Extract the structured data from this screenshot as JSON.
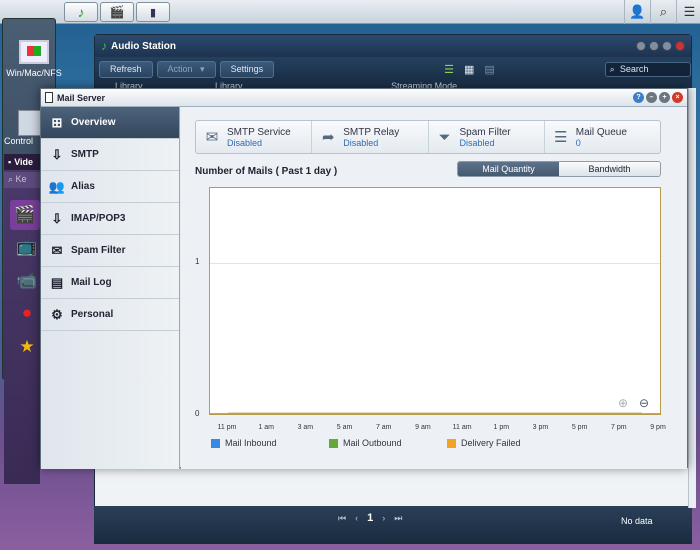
{
  "desktop": {
    "icons": [
      {
        "label": "Win/Mac/NFS"
      },
      {
        "label": "Control"
      }
    ],
    "nodata": "No data"
  },
  "audio_station": {
    "title": "Audio Station",
    "toolbar": {
      "refresh": "Refresh",
      "action": "Action",
      "settings": "Settings",
      "search_placeholder": "Search"
    },
    "subheader": {
      "left": "Library",
      "mid": "Library",
      "right": "Streaming Mode"
    }
  },
  "video_station": {
    "title": "Vide",
    "search": "Ke"
  },
  "mail_server": {
    "title": "Mail Server",
    "nav": [
      {
        "label": "Overview",
        "icon": "overview-icon"
      },
      {
        "label": "SMTP",
        "icon": "smtp-icon"
      },
      {
        "label": "Alias",
        "icon": "alias-icon"
      },
      {
        "label": "IMAP/POP3",
        "icon": "imap-icon"
      },
      {
        "label": "Spam Filter",
        "icon": "spam-filter-icon"
      },
      {
        "label": "Mail Log",
        "icon": "mail-log-icon"
      },
      {
        "label": "Personal",
        "icon": "gear-icon"
      }
    ],
    "status": [
      {
        "name": "SMTP Service",
        "value": "Disabled"
      },
      {
        "name": "SMTP Relay",
        "value": "Disabled"
      },
      {
        "name": "Spam Filter",
        "value": "Disabled"
      },
      {
        "name": "Mail Queue",
        "value": "0"
      }
    ],
    "chart_toggle": {
      "quantity": "Mail Quantity",
      "bandwidth": "Bandwidth",
      "selected": "Mail Quantity"
    }
  },
  "pager": {
    "page": "1"
  },
  "chart_data": {
    "type": "line",
    "title": "Number of Mails ( Past 1 day )",
    "categories": [
      "11 pm",
      "1 am",
      "3 am",
      "5 am",
      "7 am",
      "9 am",
      "11 am",
      "1 pm",
      "3 pm",
      "5 pm",
      "7 pm",
      "9 pm"
    ],
    "yticks": [
      "0",
      "1"
    ],
    "ylim": [
      0,
      1
    ],
    "grid": true,
    "legend_position": "bottom",
    "series": [
      {
        "name": "Mail Inbound",
        "color": "#3a87e6",
        "values": [
          0,
          0,
          0,
          0,
          0,
          0,
          0,
          0,
          0,
          0,
          0,
          0
        ]
      },
      {
        "name": "Mail Outbound",
        "color": "#62a83a",
        "values": [
          0,
          0,
          0,
          0,
          0,
          0,
          0,
          0,
          0,
          0,
          0,
          0
        ]
      },
      {
        "name": "Delivery Failed",
        "color": "#f2a227",
        "values": [
          0,
          0,
          0,
          0,
          0,
          0,
          0,
          0,
          0,
          0,
          0,
          0
        ]
      }
    ]
  }
}
